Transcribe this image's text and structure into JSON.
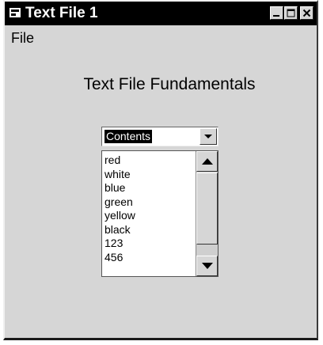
{
  "window": {
    "title": "Text File 1",
    "controls": {
      "minimize_icon": "minimize-icon",
      "maximize_icon": "maximize-icon",
      "close_icon": "close-icon"
    }
  },
  "menu": {
    "items": [
      {
        "label": "File"
      }
    ]
  },
  "main": {
    "heading": "Text File Fundamentals"
  },
  "combo": {
    "value": "Contents",
    "icon": "chevron-down-icon"
  },
  "list": {
    "items": [
      "red",
      "white",
      "blue",
      "green",
      "yellow",
      "black",
      "123",
      "456"
    ]
  },
  "colors": {
    "titlebar": "#000000",
    "window_bg": "#d6d6d6",
    "selection": "#000000"
  }
}
